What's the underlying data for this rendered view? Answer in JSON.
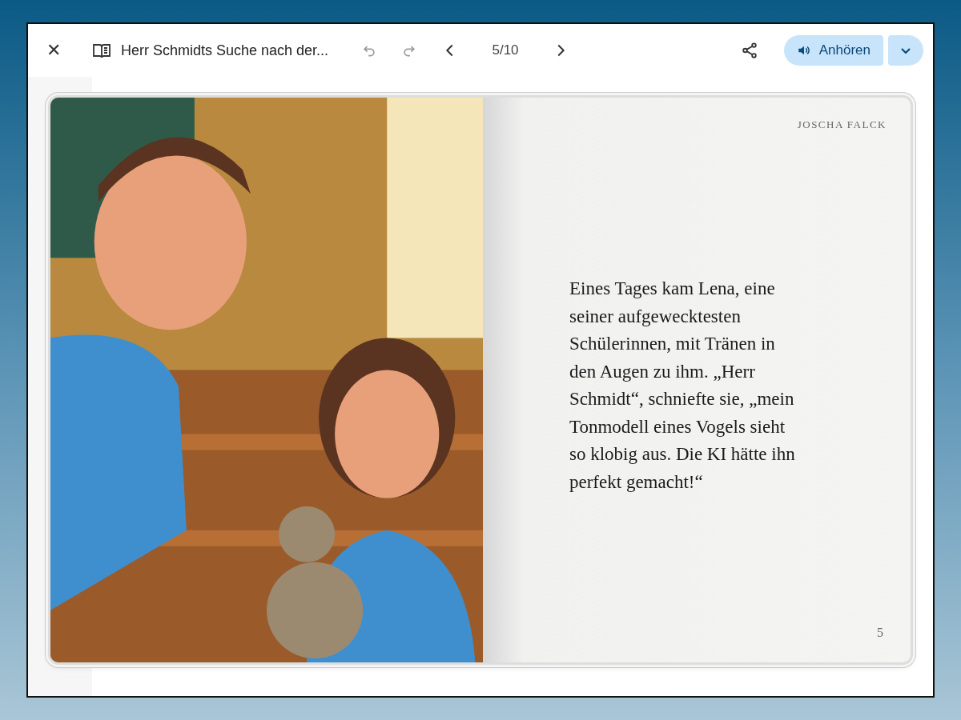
{
  "toolbar": {
    "close": "✕",
    "title": "Herr Schmidts Suche nach der...",
    "undo": {
      "disabled": true
    },
    "redo": {
      "disabled": true
    },
    "page_indicator": "5/10",
    "listen_button": "Anhören"
  },
  "book": {
    "right_page": {
      "author": "JOSCHA FALCK",
      "text": "Eines Tages kam Lena, eine seiner aufgewecktesten Schülerinnen, mit Tränen in den Augen zu ihm. „Herr Schmidt“, schniefte sie, „mein Tonmodell eines Vogels sieht so klobig aus. Die KI hätte ihn perfekt gemacht!“",
      "page_number": "5"
    }
  }
}
